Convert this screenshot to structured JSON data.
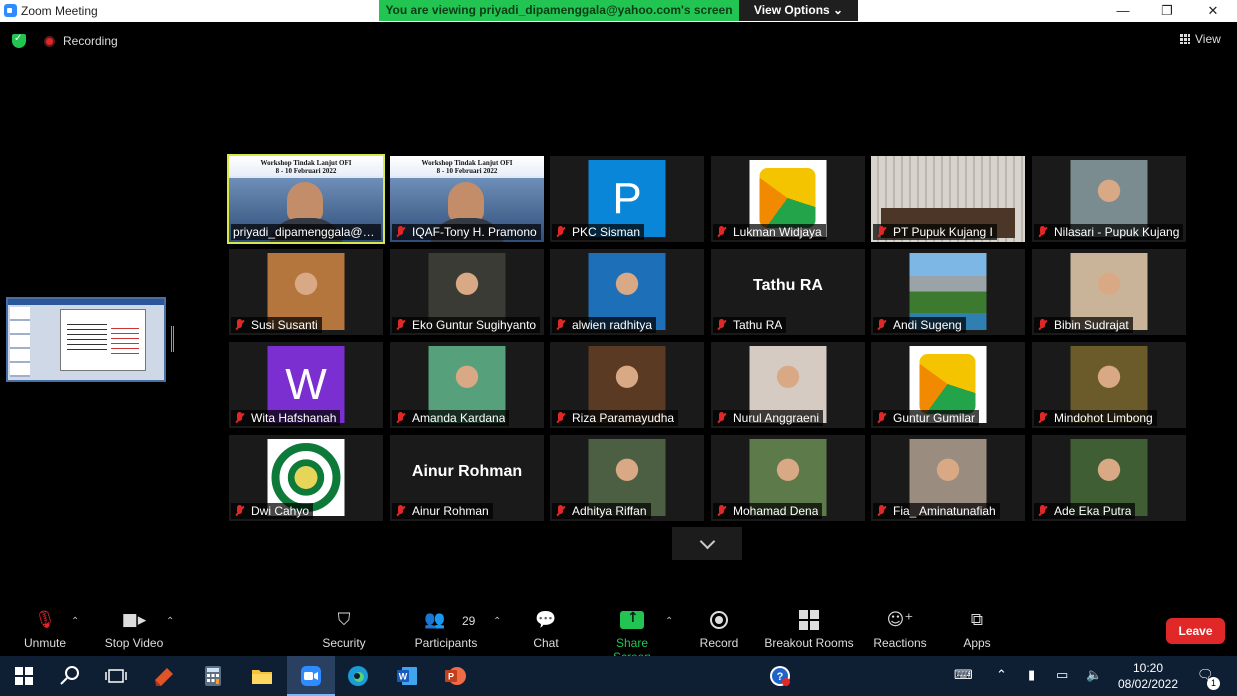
{
  "window": {
    "title": "Zoom Meeting",
    "share_banner": "You are viewing priyadi_dipamenggala@yahoo.com's screen",
    "view_options": "View Options ⌄",
    "minimize": "—",
    "restore": "❐",
    "close": "✕"
  },
  "top_strip": {
    "recording_label": "Recording",
    "view_label": "View"
  },
  "participants": [
    {
      "name": "priyadi_dipamenggala@y...",
      "muted": false,
      "active": true,
      "kind": "workshop",
      "banner": "Workshop Tindak Lanjut OFI\n8 - 10 Februari 2022"
    },
    {
      "name": "IQAF-Tony H. Pramono",
      "muted": true,
      "kind": "workshop",
      "banner": "Workshop Tindak Lanjut OFI\n8 - 10 Februari 2022"
    },
    {
      "name": "PKC Sisman",
      "muted": true,
      "kind": "letter",
      "letter": "P",
      "color": "#0a86d8"
    },
    {
      "name": "Lukman Widjaya",
      "muted": true,
      "kind": "logo46"
    },
    {
      "name": "PT Pupuk Kujang I",
      "muted": true,
      "kind": "room"
    },
    {
      "name": "Nilasari - Pupuk Kujang",
      "muted": true,
      "kind": "photo",
      "color": "#7a8c8f"
    },
    {
      "name": "Susi Susanti",
      "muted": true,
      "kind": "photo",
      "color": "#b5763e"
    },
    {
      "name": "Eko Guntur Sugihyanto",
      "muted": true,
      "kind": "photo",
      "color": "#3b3b36"
    },
    {
      "name": "alwien radhitya",
      "muted": true,
      "kind": "photo",
      "color": "#1d6fb8"
    },
    {
      "name": "Tathu RA",
      "muted": true,
      "kind": "text",
      "text": "Tathu RA"
    },
    {
      "name": "Andi Sugeng",
      "muted": true,
      "kind": "landscape"
    },
    {
      "name": "Bibin Sudrajat",
      "muted": true,
      "kind": "photo",
      "color": "#c9b49a"
    },
    {
      "name": "Wita Hafshanah",
      "muted": true,
      "kind": "letter",
      "letter": "W",
      "color": "#7b2fd1"
    },
    {
      "name": "Amanda Kardana",
      "muted": true,
      "kind": "photo",
      "color": "#56a07b"
    },
    {
      "name": "Riza Paramayudha",
      "muted": true,
      "kind": "photo",
      "color": "#5a3a22"
    },
    {
      "name": "Nurul Anggraeni",
      "muted": true,
      "kind": "photo",
      "color": "#d6cbc2"
    },
    {
      "name": "Guntur Gumilar",
      "muted": true,
      "kind": "logo46"
    },
    {
      "name": "Mindohot Limbong",
      "muted": true,
      "kind": "photo",
      "color": "#6b5a2a"
    },
    {
      "name": "Dwi Cahyo",
      "muted": true,
      "kind": "emblem"
    },
    {
      "name": "Ainur Rohman",
      "muted": true,
      "kind": "text",
      "text": "Ainur Rohman"
    },
    {
      "name": "Adhitya Riffan",
      "muted": true,
      "kind": "photo",
      "color": "#4d5f43"
    },
    {
      "name": "Mohamad Dena",
      "muted": true,
      "kind": "photo",
      "color": "#5d7a4a"
    },
    {
      "name": "Fia_ Aminatunafiah",
      "muted": true,
      "kind": "photo",
      "color": "#9a8d80"
    },
    {
      "name": "Ade Eka Putra",
      "muted": true,
      "kind": "photo",
      "color": "#3f5e34"
    }
  ],
  "toolbar": {
    "unmute": "Unmute",
    "stop_video": "Stop Video",
    "security": "Security",
    "participants": "Participants",
    "participants_count": "29",
    "chat": "Chat",
    "share_screen": "Share Screen",
    "record": "Record",
    "breakout_rooms": "Breakout Rooms",
    "reactions": "Reactions",
    "apps": "Apps",
    "leave": "Leave"
  },
  "taskbar": {
    "time": "10:20",
    "date": "08/02/2022",
    "notifications": "1"
  },
  "colors": {
    "accent_green": "#23c552",
    "leave_red": "#e02828",
    "active_speaker": "#d8e84a",
    "taskbar_bg": "#0f1f33"
  }
}
